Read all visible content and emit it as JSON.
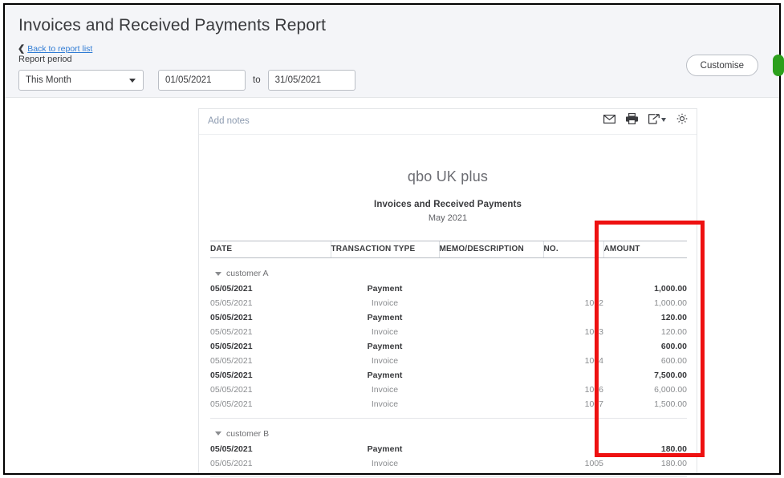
{
  "header": {
    "page_title": "Invoices and Received Payments Report",
    "back_link": "Back to report list",
    "back_chevron_icon": "chevron-left-icon",
    "report_period_label": "Report period",
    "period_select_value": "This Month",
    "period_select_caret_icon": "chevron-down-icon",
    "date_from": "01/05/2021",
    "date_to": "31/05/2021",
    "date_from_placeholder": "dd/mm/yyyy",
    "date_to_placeholder": "dd/mm/yyyy",
    "to_word": "to",
    "customise_button": "Customise",
    "band_color": "#f4f5f8",
    "link_color": "#2f7bd4",
    "green_accent": "#2ca01c"
  },
  "card": {
    "add_notes": "Add notes",
    "toolbar_icons": [
      {
        "name": "email-icon",
        "title": "Email"
      },
      {
        "name": "print-icon",
        "title": "Print"
      },
      {
        "name": "export-icon",
        "title": "Export"
      },
      {
        "name": "gear-icon",
        "title": "Settings"
      }
    ]
  },
  "report": {
    "company_name": "qbo UK plus",
    "report_name": "Invoices and Received Payments",
    "date_range": "May 2021"
  },
  "table": {
    "columns": [
      "DATE",
      "TRANSACTION TYPE",
      "MEMO/DESCRIPTION",
      "NO.",
      "AMOUNT"
    ],
    "groups": [
      {
        "label": "customer A",
        "collapse_icon": "triangle-down-icon",
        "rows": [
          {
            "date": "05/05/2021",
            "type": "Payment",
            "memo": "",
            "no": "",
            "amount": "1,000.00",
            "bold": true
          },
          {
            "date": "05/05/2021",
            "type": "Invoice",
            "memo": "",
            "no": "1002",
            "amount": "1,000.00",
            "bold": false
          },
          {
            "date": "05/05/2021",
            "type": "Payment",
            "memo": "",
            "no": "",
            "amount": "120.00",
            "bold": true
          },
          {
            "date": "05/05/2021",
            "type": "Invoice",
            "memo": "",
            "no": "1003",
            "amount": "120.00",
            "bold": false
          },
          {
            "date": "05/05/2021",
            "type": "Payment",
            "memo": "",
            "no": "",
            "amount": "600.00",
            "bold": true
          },
          {
            "date": "05/05/2021",
            "type": "Invoice",
            "memo": "",
            "no": "1004",
            "amount": "600.00",
            "bold": false
          },
          {
            "date": "05/05/2021",
            "type": "Payment",
            "memo": "",
            "no": "",
            "amount": "7,500.00",
            "bold": true
          },
          {
            "date": "05/05/2021",
            "type": "Invoice",
            "memo": "",
            "no": "1006",
            "amount": "6,000.00",
            "bold": false
          },
          {
            "date": "05/05/2021",
            "type": "Invoice",
            "memo": "",
            "no": "1007",
            "amount": "1,500.00",
            "bold": false
          }
        ]
      },
      {
        "label": "customer B",
        "collapse_icon": "triangle-down-icon",
        "rows": [
          {
            "date": "05/05/2021",
            "type": "Payment",
            "memo": "",
            "no": "",
            "amount": "180.00",
            "bold": true
          },
          {
            "date": "05/05/2021",
            "type": "Invoice",
            "memo": "",
            "no": "1005",
            "amount": "180.00",
            "bold": false
          }
        ]
      }
    ]
  },
  "annotation": {
    "highlight_color": "#ee1111",
    "highlight_target_column": "AMOUNT"
  }
}
